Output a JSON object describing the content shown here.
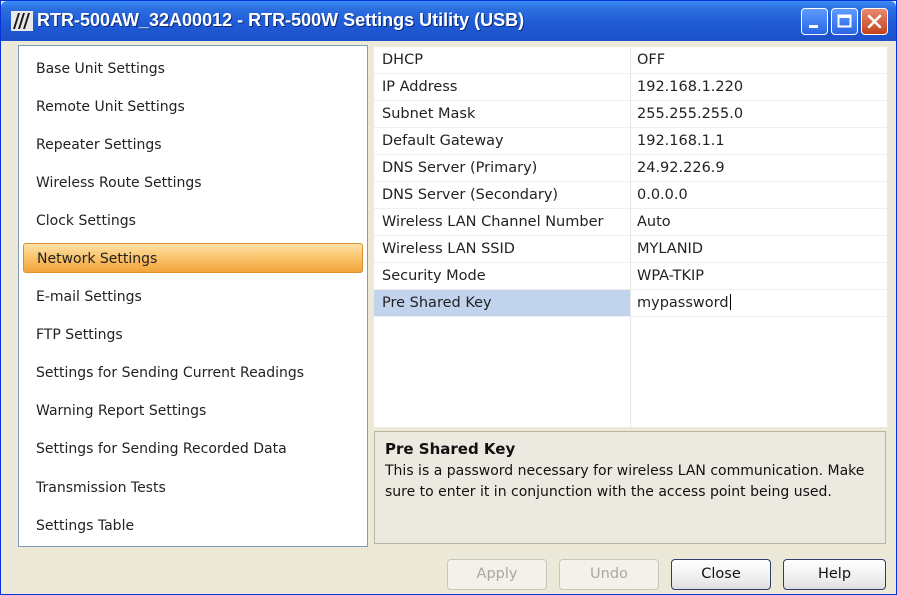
{
  "window": {
    "title": "RTR-500AW_32A00012 - RTR-500W Settings Utility (USB)"
  },
  "nav": {
    "items": [
      {
        "label": "Base Unit Settings"
      },
      {
        "label": "Remote Unit Settings"
      },
      {
        "label": "Repeater Settings"
      },
      {
        "label": "Wireless Route Settings"
      },
      {
        "label": "Clock Settings"
      },
      {
        "label": "Network Settings"
      },
      {
        "label": "E-mail Settings"
      },
      {
        "label": "FTP Settings"
      },
      {
        "label": "Settings for Sending Current Readings"
      },
      {
        "label": "Warning Report Settings"
      },
      {
        "label": "Settings for Sending Recorded Data"
      },
      {
        "label": "Transmission Tests"
      },
      {
        "label": "Settings Table"
      }
    ],
    "selected": "Network Settings"
  },
  "grid": {
    "rows": [
      {
        "name": "DHCP",
        "value": "OFF"
      },
      {
        "name": "IP Address",
        "value": "192.168.1.220"
      },
      {
        "name": "Subnet Mask",
        "value": "255.255.255.0"
      },
      {
        "name": "Default Gateway",
        "value": "192.168.1.1"
      },
      {
        "name": "DNS Server (Primary)",
        "value": "24.92.226.9"
      },
      {
        "name": "DNS Server (Secondary)",
        "value": "0.0.0.0"
      },
      {
        "name": "Wireless LAN Channel Number",
        "value": "Auto"
      },
      {
        "name": "Wireless LAN SSID",
        "value": "MYLANID"
      },
      {
        "name": "Security Mode",
        "value": "WPA-TKIP"
      },
      {
        "name": "Pre Shared Key",
        "value": "mypassword"
      }
    ],
    "selected": "Pre Shared Key"
  },
  "description": {
    "title": "Pre Shared Key",
    "text": "This is a password necessary for wireless LAN communication. Make sure to enter it in conjunction with the access point being used."
  },
  "buttons": {
    "apply": "Apply",
    "undo": "Undo",
    "close": "Close",
    "help": "Help"
  },
  "colors": {
    "titlebar": "#1f5bd6",
    "selected_nav": "#f9c26a",
    "selected_row": "#c2d3ee"
  }
}
